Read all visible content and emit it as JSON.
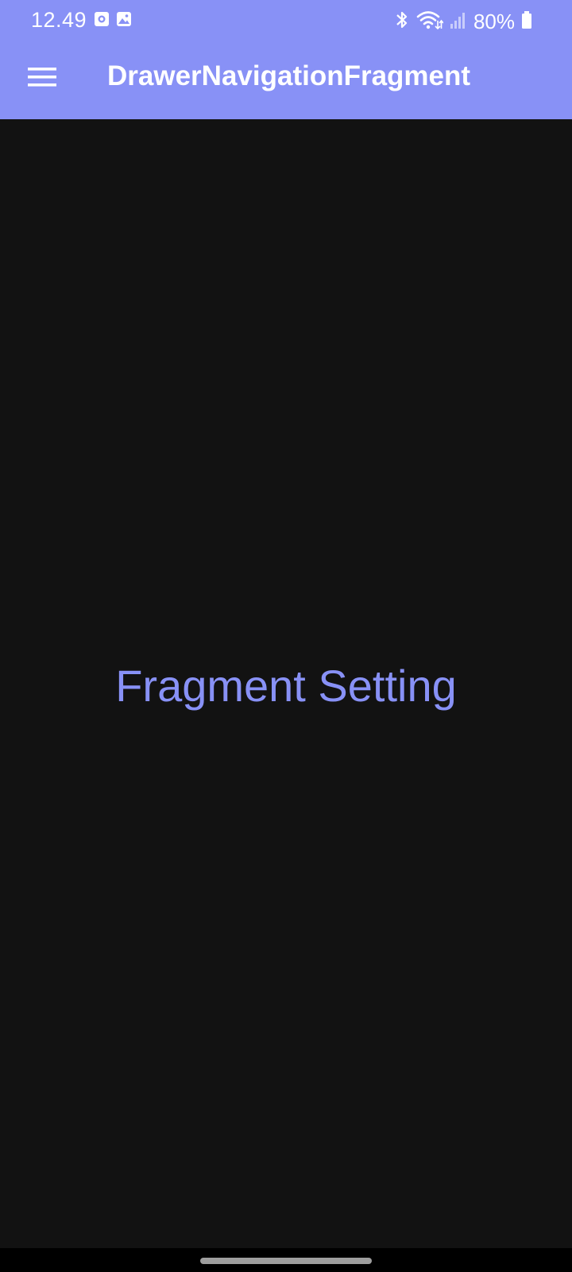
{
  "status_bar": {
    "time": "12.49",
    "battery": "80%",
    "notification_icons": [
      "screen-record-icon",
      "image-icon"
    ],
    "system_icons": [
      "bluetooth-icon",
      "wifi-icon",
      "signal-icon",
      "battery-icon"
    ]
  },
  "toolbar": {
    "menu_icon": "hamburger-menu-icon",
    "title": "DrawerNavigationFragment"
  },
  "main": {
    "fragment_text": "Fragment Setting"
  },
  "colors": {
    "primary": "#8891f6",
    "background": "#121212",
    "on_primary": "#ffffff",
    "nav_bar": "#000000"
  }
}
